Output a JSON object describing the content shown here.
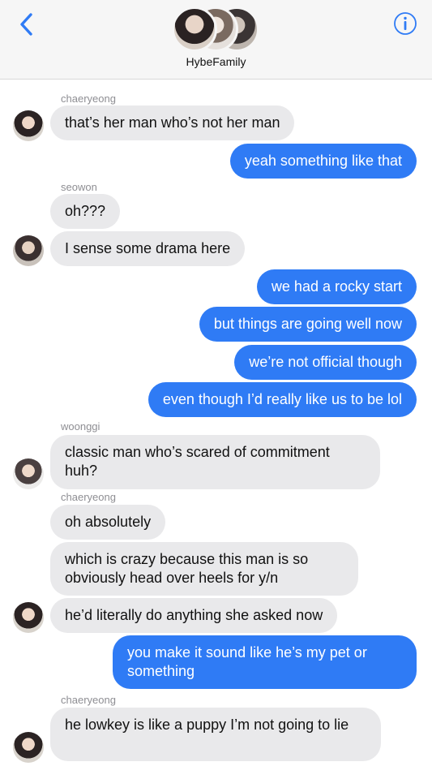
{
  "header": {
    "back_icon": "chevron-left-icon",
    "info_icon": "info-icon",
    "group_name": "HybeFamily",
    "accent": "#2f7bf5"
  },
  "messages": [
    {
      "kind": "sender",
      "text": "chaeryeong"
    },
    {
      "kind": "received",
      "text": "that’s her man who’s not her man"
    },
    {
      "kind": "sent",
      "text": "yeah something like that"
    },
    {
      "kind": "sender",
      "text": "seowon"
    },
    {
      "kind": "received",
      "text": "oh???"
    },
    {
      "kind": "received",
      "text": "I sense some drama here"
    },
    {
      "kind": "sent",
      "text": "we had a rocky start"
    },
    {
      "kind": "sent",
      "text": "but things are going well now"
    },
    {
      "kind": "sent",
      "text": "we’re not official though"
    },
    {
      "kind": "sent",
      "text": "even though I’d really like us to be lol"
    },
    {
      "kind": "sender",
      "text": "woonggi"
    },
    {
      "kind": "received",
      "text": "classic man who’s scared of commitment huh?"
    },
    {
      "kind": "sender",
      "text": "chaeryeong"
    },
    {
      "kind": "received",
      "text": "oh absolutely"
    },
    {
      "kind": "received",
      "text": "which is crazy because this man is so obviously head over heels for y/n"
    },
    {
      "kind": "received",
      "text": "he’d literally do anything she asked now"
    },
    {
      "kind": "sent",
      "text": "you make it sound like he’s my pet or something"
    },
    {
      "kind": "sender",
      "text": "chaeryeong"
    },
    {
      "kind": "received",
      "text": "he lowkey is like a puppy I’m not going to lie"
    }
  ],
  "colors": {
    "sent_bubble": "#2f7bf5",
    "received_bubble": "#e9e9eb",
    "header_bg": "#f6f6f6"
  }
}
